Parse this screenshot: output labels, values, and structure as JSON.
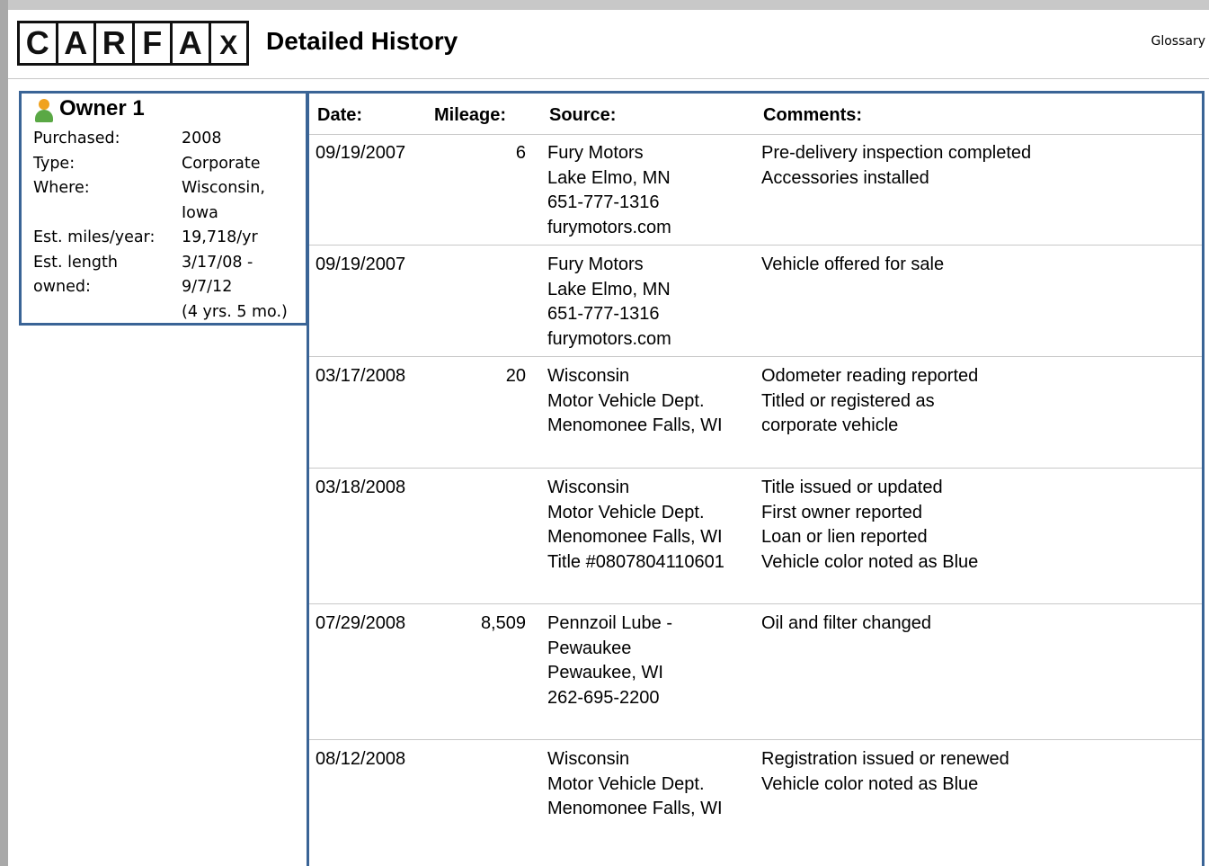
{
  "header": {
    "logo_letters": [
      "C",
      "A",
      "R",
      "F",
      "A",
      "X"
    ],
    "title": "Detailed History",
    "glossary_label": "Glossary"
  },
  "owner": {
    "icon": "person-icon",
    "name": "Owner 1",
    "details": [
      {
        "label": "Purchased:",
        "value": [
          "2008"
        ]
      },
      {
        "label": "Type:",
        "value": [
          "Corporate"
        ]
      },
      {
        "label": "Where:",
        "value": [
          "Wisconsin,",
          "Iowa"
        ]
      },
      {
        "label": "Est. miles/year:",
        "value": [
          "19,718/yr"
        ]
      },
      {
        "label": "Est. length",
        "value": [
          "3/17/08 -"
        ]
      },
      {
        "label": "owned:",
        "value": [
          "9/7/12",
          "(4 yrs. 5 mo.)"
        ]
      }
    ]
  },
  "table": {
    "headers": {
      "date": "Date:",
      "mileage": "Mileage:",
      "source": "Source:",
      "comments": "Comments:"
    },
    "records": [
      {
        "date": "09/19/2007",
        "mileage": "6",
        "source": [
          "Fury Motors",
          "Lake Elmo, MN",
          "651-777-1316",
          "furymotors.com"
        ],
        "comments": [
          "Pre-delivery inspection completed",
          "Accessories installed"
        ]
      },
      {
        "date": "09/19/2007",
        "mileage": "",
        "source": [
          "Fury Motors",
          "Lake Elmo, MN",
          "651-777-1316",
          "furymotors.com"
        ],
        "comments": [
          "Vehicle offered for sale"
        ]
      },
      {
        "date": "03/17/2008",
        "mileage": "20",
        "source": [
          "Wisconsin",
          "Motor Vehicle Dept.",
          "Menomonee Falls, WI"
        ],
        "comments": [
          "Odometer reading reported",
          "Titled or registered as",
          "corporate vehicle"
        ]
      },
      {
        "date": "03/18/2008",
        "mileage": "",
        "source": [
          "Wisconsin",
          "Motor Vehicle Dept.",
          "Menomonee Falls, WI",
          "Title #0807804110601"
        ],
        "comments": [
          "Title issued or updated",
          "First owner reported",
          "Loan or lien reported",
          "Vehicle color noted as Blue"
        ]
      },
      {
        "date": "07/29/2008",
        "mileage": "8,509",
        "source": [
          "Pennzoil Lube -",
          "Pewaukee",
          "Pewaukee, WI",
          "262-695-2200"
        ],
        "comments": [
          "Oil and filter changed"
        ]
      },
      {
        "date": "08/12/2008",
        "mileage": "",
        "source": [
          "Wisconsin",
          "Motor Vehicle Dept.",
          "Menomonee Falls, WI"
        ],
        "comments": [
          "Registration issued or renewed",
          "Vehicle color noted as Blue"
        ]
      }
    ]
  }
}
